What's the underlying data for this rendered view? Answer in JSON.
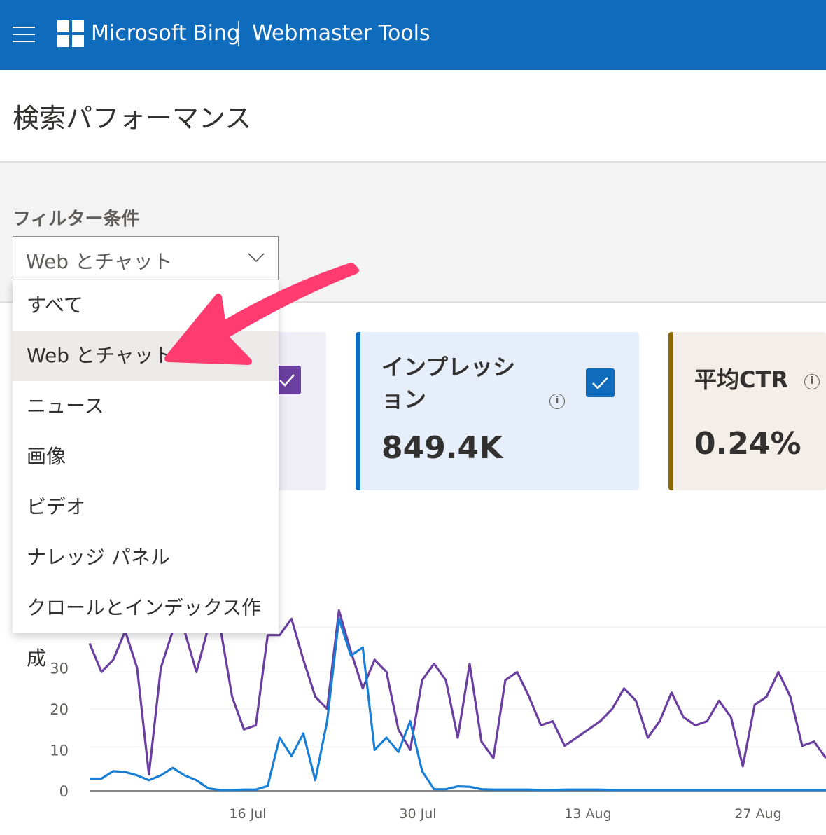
{
  "header": {
    "brand": "Microsoft Bing",
    "product": "Webmaster Tools",
    "accent_color": "#0f6cbd"
  },
  "page": {
    "title": "検索パフォーマンス"
  },
  "filter": {
    "label": "フィルター条件",
    "selected": "Web とチャット",
    "options": [
      "すべて",
      "Web とチャット",
      "ニュース",
      "画像",
      "ビデオ",
      "ナレッジ パネル",
      "クロールとインデックス作成"
    ],
    "selected_index": 1
  },
  "cards": {
    "impressions": {
      "title_line1": "インプレッシ",
      "title_line2": "ョン",
      "value": "849.4K",
      "checked": true,
      "color": "#0f6cbd"
    },
    "ctr": {
      "title": "平均CTR",
      "value": "0.24%",
      "color": "#8e6a00"
    },
    "clicks": {
      "checked": true,
      "color": "#6b3fa0"
    }
  },
  "chart_data": {
    "type": "line",
    "x_tick_labels": [
      "16 Jul",
      "30 Jul",
      "13 Aug",
      "27 Aug"
    ],
    "y_tick_labels": [
      "0",
      "10",
      "20",
      "30"
    ],
    "ylim": [
      0,
      40
    ],
    "series": [
      {
        "color": "#6b3fa0",
        "values": [
          36,
          29,
          32,
          39,
          30,
          4,
          30,
          39,
          39,
          29,
          40,
          40,
          23,
          15,
          16,
          38,
          38,
          42,
          32,
          23,
          20,
          44,
          34,
          25,
          32,
          29,
          15,
          10,
          27,
          31,
          27,
          13,
          31,
          12,
          8,
          27,
          29,
          23,
          16,
          17,
          11,
          13,
          15,
          17,
          20,
          25,
          22,
          13,
          17,
          24,
          18,
          16,
          17,
          22,
          18,
          6,
          21,
          23,
          29,
          23,
          11,
          12,
          8
        ]
      },
      {
        "color": "#1a7fd4",
        "values": [
          3,
          3,
          4.8,
          4.6,
          3.8,
          2.6,
          3.8,
          5.6,
          3.8,
          2.6,
          0.6,
          0.2,
          0.2,
          0.3,
          0.3,
          1.2,
          13,
          8.5,
          14,
          2.6,
          17,
          42,
          33,
          35,
          10,
          13,
          9.5,
          17,
          4.8,
          0.4,
          0.4,
          1.1,
          1.0,
          0.4,
          0.3,
          0.3,
          0.3,
          0.3,
          0.2,
          0.2,
          0.3,
          0.3,
          0.3,
          0.3,
          0.2,
          0.2,
          0.2,
          0.2,
          0.2,
          0.2,
          0.2,
          0.2,
          0.2,
          0.2,
          0.2,
          0.2,
          0.2,
          0.2,
          0.2,
          0.2,
          0.2,
          0.2,
          0.2
        ]
      }
    ]
  }
}
